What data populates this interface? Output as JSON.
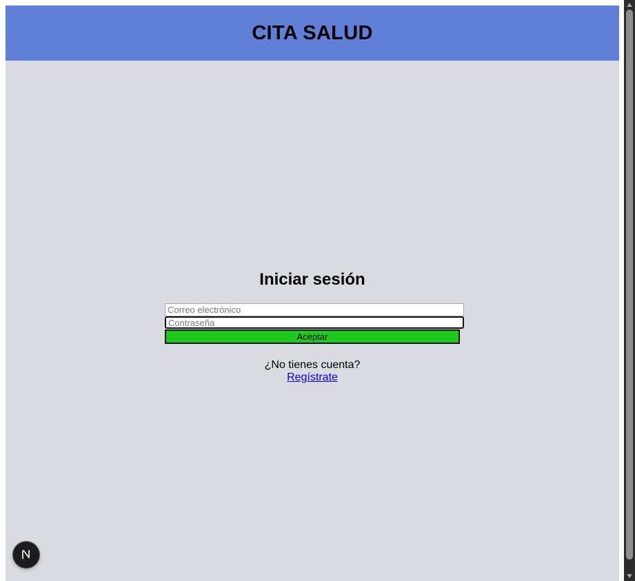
{
  "header": {
    "title": "CITA SALUD"
  },
  "login": {
    "title": "Iniciar sesión",
    "email_placeholder": "Correo electrónico",
    "password_placeholder": "Contraseña",
    "submit_label": "Aceptar"
  },
  "signup": {
    "prompt": "¿No tienes cuenta?",
    "link_label": "Regístrate"
  },
  "dev_badge": {
    "icon": "nextjs-logo-icon"
  },
  "colors": {
    "header_bg": "#617fd6",
    "page_bg": "#dadbe0",
    "submit_bg": "#1ec91e",
    "link": "#0000ee"
  }
}
